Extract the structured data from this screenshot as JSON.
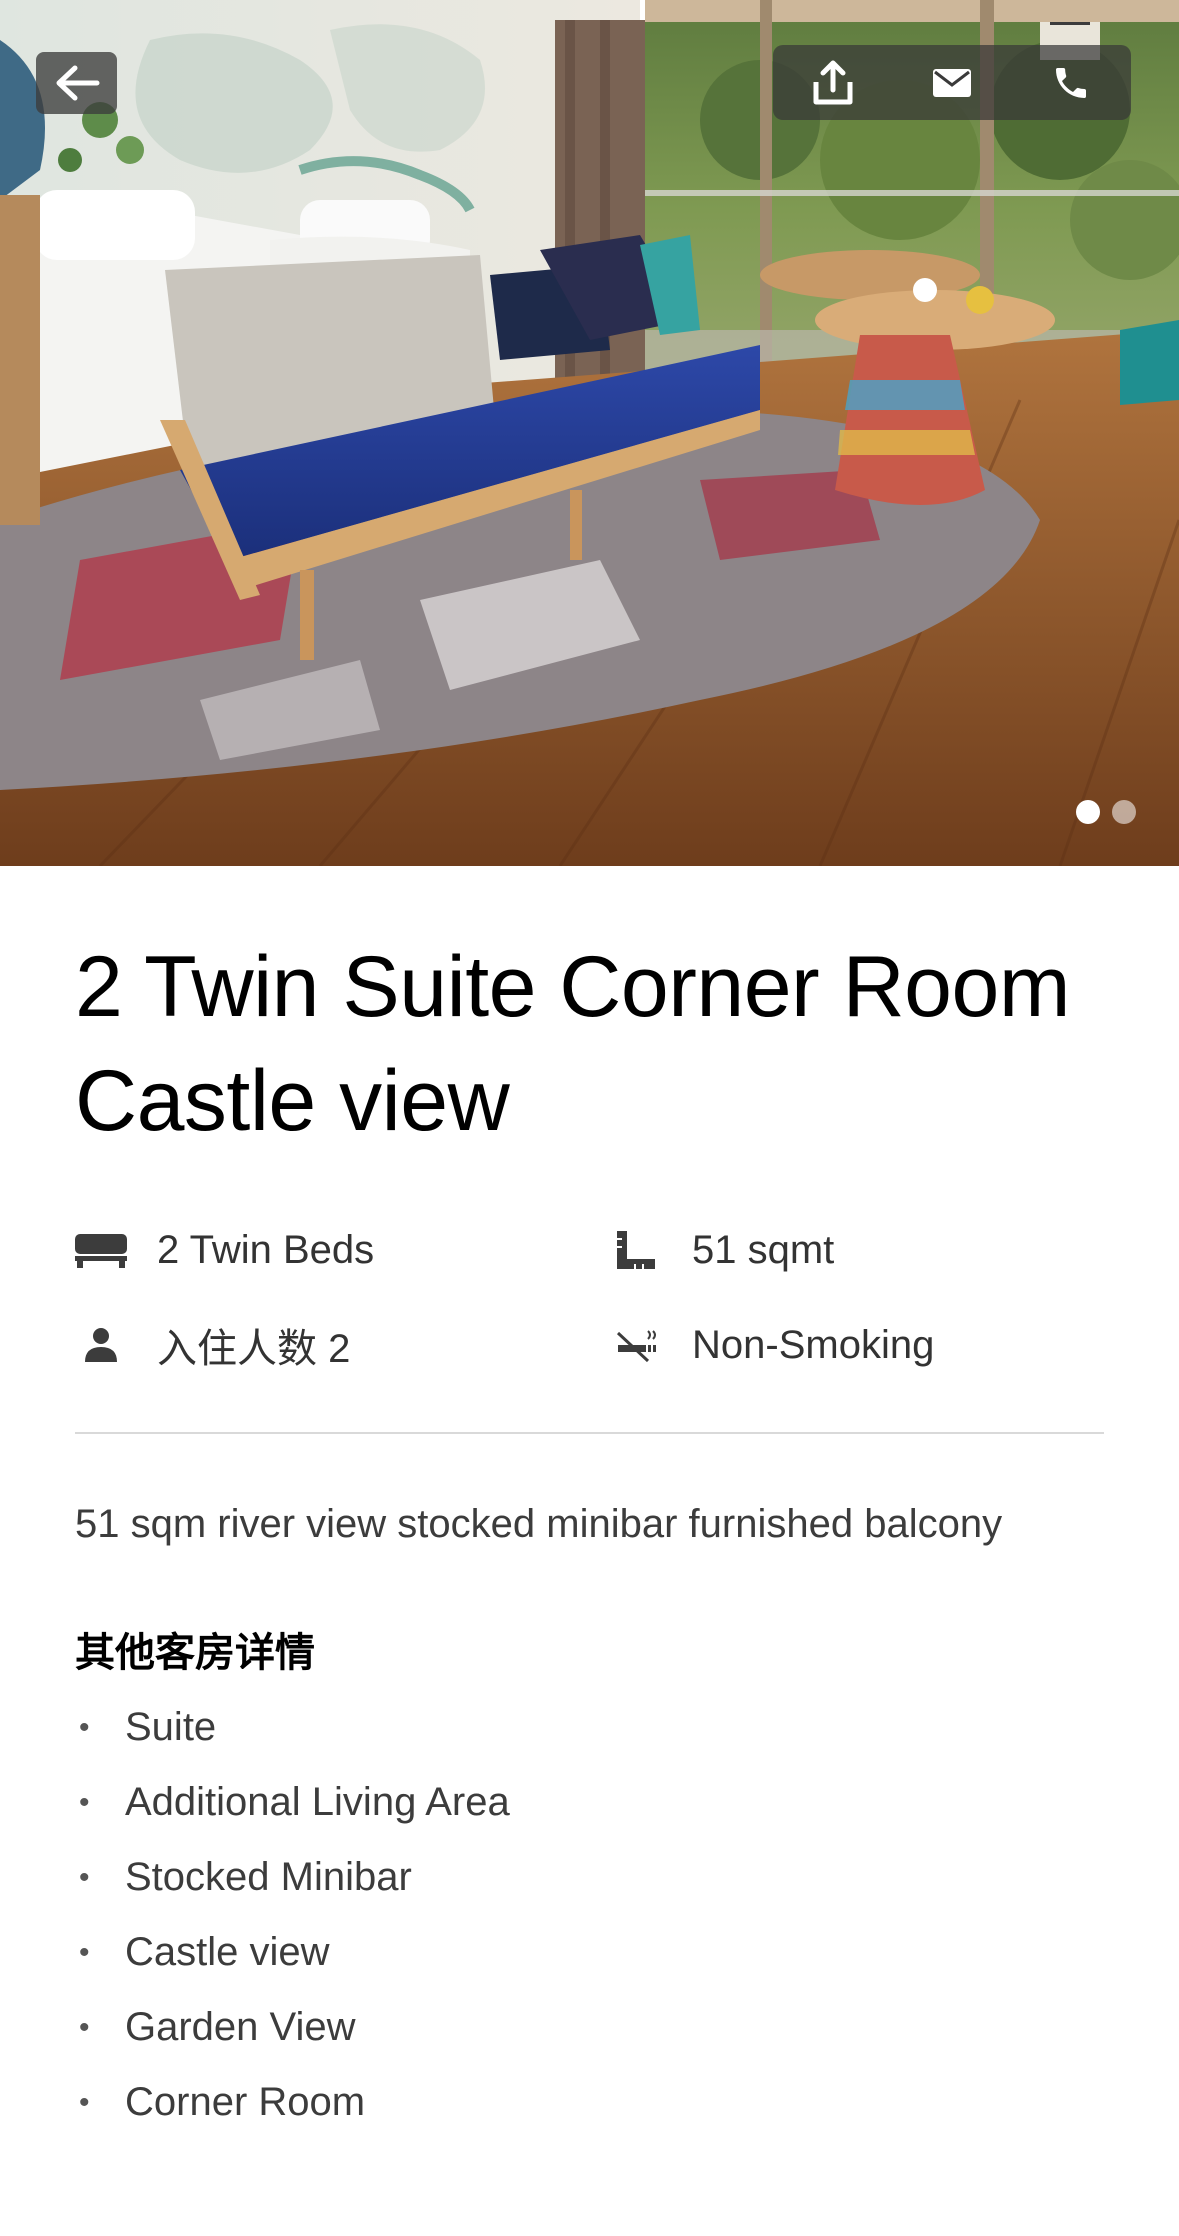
{
  "hero": {
    "photo_alt": "Hotel suite with twin beds, blue sofa and castle view balcony",
    "pager": {
      "count": 2,
      "active": 0
    }
  },
  "header": {
    "back_icon": "arrow-left-icon",
    "actions": [
      {
        "name": "share",
        "icon": "share-icon"
      },
      {
        "name": "email",
        "icon": "mail-icon"
      },
      {
        "name": "call",
        "icon": "phone-icon"
      }
    ]
  },
  "room": {
    "title": "2 Twin Suite Corner Room Castle view",
    "facts": {
      "beds": {
        "icon": "bed-icon",
        "label": "2 Twin Beds"
      },
      "size": {
        "icon": "ruler-icon",
        "label": "51 sqmt"
      },
      "occupancy": {
        "icon": "person-icon",
        "label": "入住人数 2"
      },
      "smoking": {
        "icon": "no-smoking-icon",
        "label": "Non-Smoking"
      }
    },
    "description": "51 sqm river view stocked minibar furnished balcony",
    "details_heading": "其他客房详情",
    "details": [
      "Suite",
      "Additional Living Area",
      "Stocked Minibar",
      "Castle view",
      "Garden View",
      "Corner Room"
    ]
  }
}
